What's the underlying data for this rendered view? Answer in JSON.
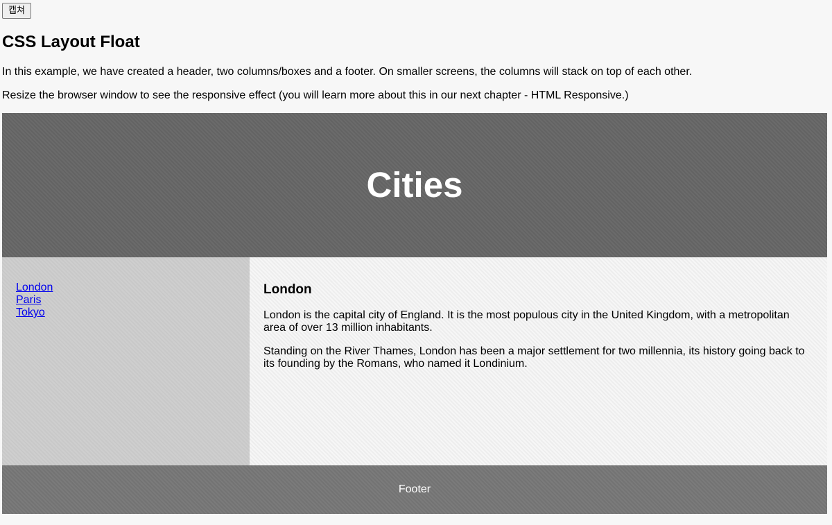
{
  "toolbar": {
    "capture_label": "캡쳐"
  },
  "page": {
    "title": "CSS Layout Float",
    "intro_1": "In this example, we have created a header, two columns/boxes and a footer. On smaller screens, the columns will stack on top of each other.",
    "intro_2": "Resize the browser window to see the responsive effect (you will learn more about this in our next chapter - HTML Responsive.)"
  },
  "header": {
    "title": "Cities"
  },
  "nav": {
    "items": [
      {
        "label": "London"
      },
      {
        "label": "Paris"
      },
      {
        "label": "Tokyo"
      }
    ]
  },
  "article": {
    "heading": "London",
    "paragraph_1": "London is the capital city of England. It is the most populous city in the United Kingdom, with a metropolitan area of over 13 million inhabitants.",
    "paragraph_2": "Standing on the River Thames, London has been a major settlement for two millennia, its history going back to its founding by the Romans, who named it Londinium."
  },
  "footer": {
    "text": "Footer"
  },
  "colors": {
    "header_bg": "#666666",
    "nav_bg": "#cccccc",
    "article_bg": "#f1f1f1",
    "footer_bg": "#777777",
    "link": "#0000ee"
  }
}
